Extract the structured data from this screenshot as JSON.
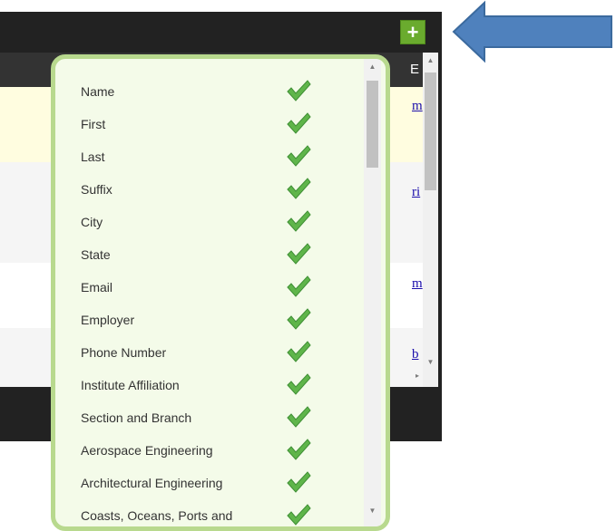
{
  "toolbar": {
    "add_label": "+"
  },
  "table": {
    "partial_header": "E",
    "row_links": [
      "m",
      "ri",
      "m",
      "b"
    ]
  },
  "column_chooser": {
    "items": [
      {
        "label": "Name",
        "checked": true
      },
      {
        "label": "First",
        "checked": true
      },
      {
        "label": "Last",
        "checked": true
      },
      {
        "label": "Suffix",
        "checked": true
      },
      {
        "label": "City",
        "checked": true
      },
      {
        "label": "State",
        "checked": true
      },
      {
        "label": "Email",
        "checked": true
      },
      {
        "label": "Employer",
        "checked": true
      },
      {
        "label": "Phone Number",
        "checked": true
      },
      {
        "label": "Institute Affiliation",
        "checked": true
      },
      {
        "label": "Section and Branch",
        "checked": true
      },
      {
        "label": "Aerospace Engineering",
        "checked": true
      },
      {
        "label": "Architectural Engineering",
        "checked": true
      },
      {
        "label": "Coasts, Oceans, Ports and",
        "checked": true
      }
    ]
  },
  "colors": {
    "add_button": "#6aab2e",
    "popup_border": "#b8d98e",
    "popup_bg": "#f4fbe9",
    "checkmark": "#5fb54a",
    "annotation_arrow": "#4f81bd"
  }
}
